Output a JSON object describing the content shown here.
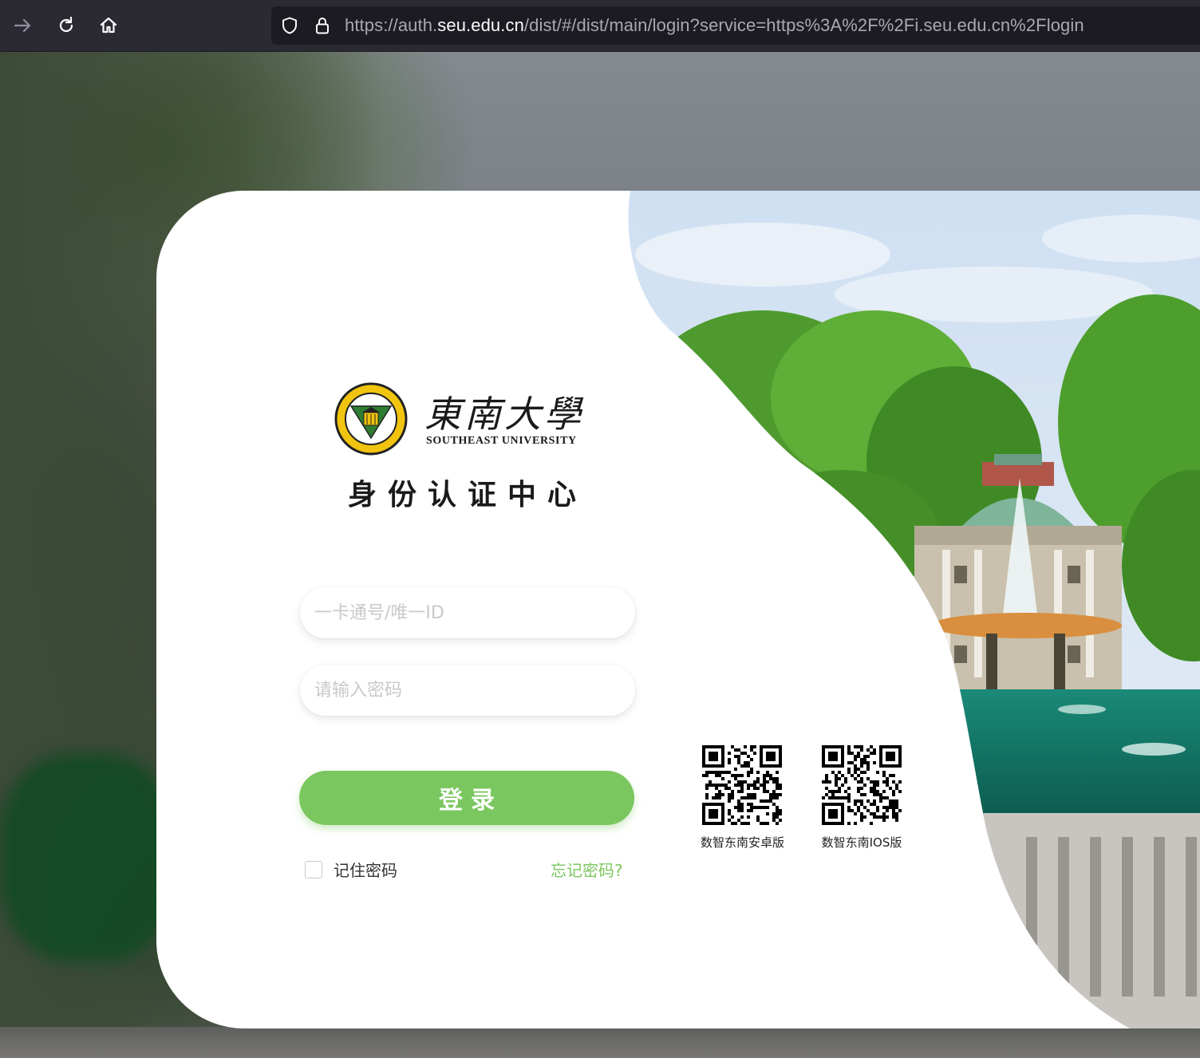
{
  "browser": {
    "url_prefix": "https://auth.",
    "url_host": "seu.edu.cn",
    "url_path": "/dist/#/dist/main/login?service=https%3A%2F%2Fi.seu.edu.cn%2Flogin",
    "icons": [
      "forward-icon",
      "reload-icon",
      "home-icon",
      "shield-icon",
      "lock-icon"
    ]
  },
  "brand": {
    "name_cn": "東南大學",
    "name_en": "SOUTHEAST UNIVERSITY",
    "system_title": "身份认证中心",
    "accent_color": "#7bc75f"
  },
  "form": {
    "username_placeholder": "一卡通号/唯一ID",
    "password_placeholder": "请输入密码",
    "login_label": "登录",
    "remember_label": "记住密码",
    "forgot_label": "忘记密码?"
  },
  "qrcodes": {
    "android_label": "数智东南安卓版",
    "ios_label": "数智东南IOS版"
  }
}
